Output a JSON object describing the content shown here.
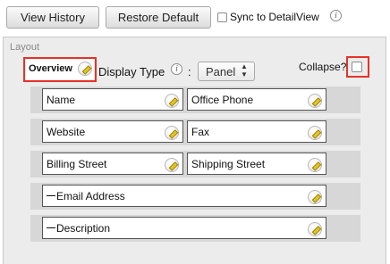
{
  "toolbar": {
    "view_history_label": "View History",
    "restore_default_label": "Restore Default",
    "sync_label": "Sync to DetailView",
    "sync_checked": false
  },
  "layout": {
    "title": "Layout",
    "panel": {
      "name": "Overview",
      "display_type_label": "Display Type",
      "colon": ":",
      "display_type_value": "Panel",
      "collapse_label": "Collapse?",
      "collapse_checked": false
    },
    "rows": [
      {
        "left": "Name",
        "right": "Office Phone"
      },
      {
        "left": "Website",
        "right": "Fax"
      },
      {
        "left": "Billing Street",
        "right": "Shipping Street"
      },
      {
        "full": "Email Address"
      },
      {
        "full": "Description"
      }
    ]
  },
  "colors": {
    "highlight": "#e63228",
    "panel_background": "#ececec",
    "row_background": "#d7d7d7"
  },
  "icons": [
    "info-icon",
    "pencil-icon",
    "select-arrows-icon",
    "minus-icon",
    "checkbox"
  ]
}
